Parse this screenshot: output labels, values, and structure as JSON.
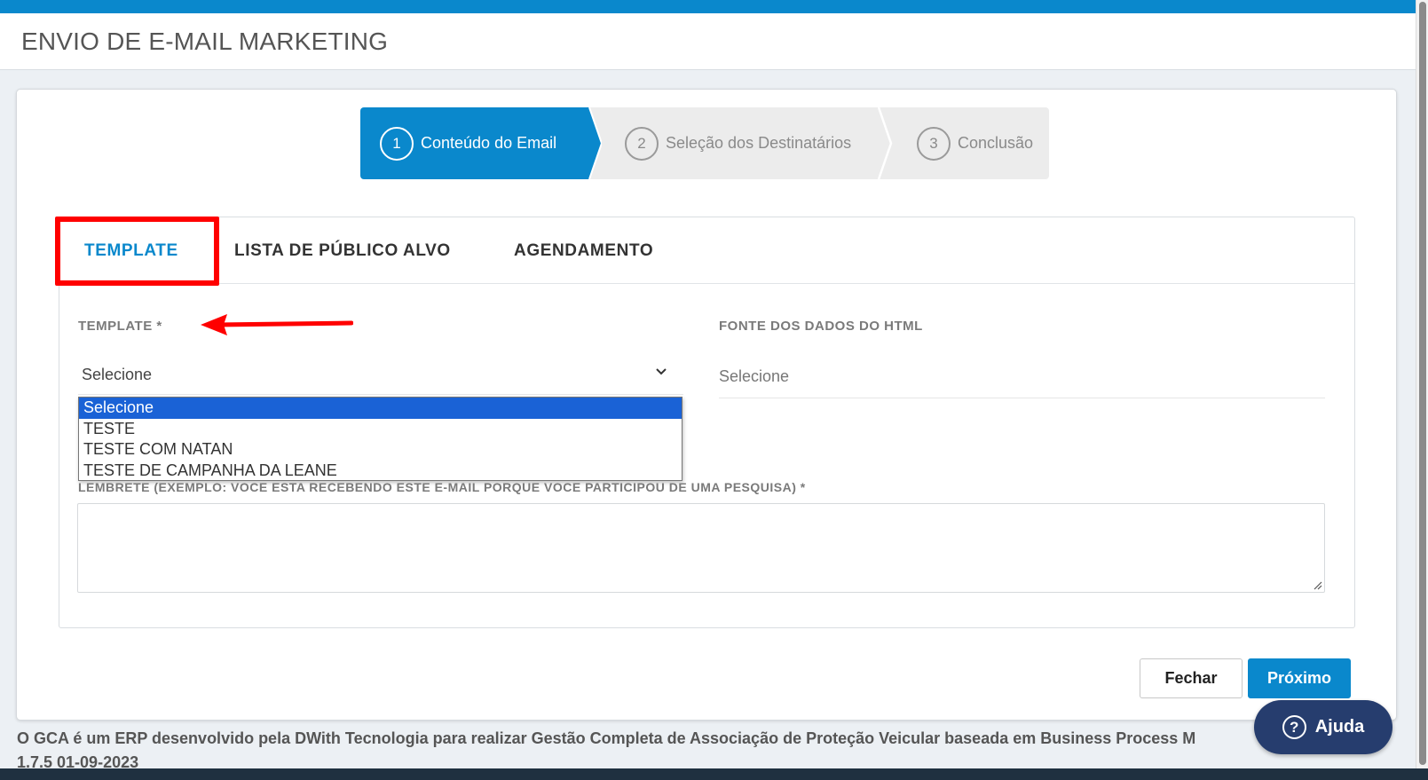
{
  "header": {
    "title": "ENVIO DE E-MAIL MARKETING"
  },
  "wizard": {
    "steps": [
      {
        "num": "1",
        "label": "Conteúdo do Email",
        "active": true
      },
      {
        "num": "2",
        "label": "Seleção dos Destinatários",
        "active": false
      },
      {
        "num": "3",
        "label": "Conclusão",
        "active": false
      }
    ]
  },
  "tabs": [
    {
      "label": "TEMPLATE",
      "active": true
    },
    {
      "label": "LISTA DE PÚBLICO ALVO",
      "active": false
    },
    {
      "label": "AGENDAMENTO",
      "active": false
    }
  ],
  "form": {
    "template_label": "TEMPLATE *",
    "template_value": "Selecione",
    "template_options": [
      "Selecione",
      "TESTE",
      "TESTE COM NATAN",
      "TESTE DE CAMPANHA DA LEANE"
    ],
    "fonte_label": "FONTE DOS DADOS DO HTML",
    "fonte_value": "Selecione",
    "lembrete_label": "LEMBRETE (EXEMPLO: VOCE ESTA RECEBENDO ESTE E-MAIL PORQUE VOCE PARTICIPOU DE UMA PESQUISA) *",
    "lembrete_value": ""
  },
  "buttons": {
    "fechar": "Fechar",
    "proximo": "Próximo"
  },
  "footer": {
    "line1": "O GCA é um ERP desenvolvido pela DWith Tecnologia para realizar Gestão Completa de Associação de Proteção Veicular baseada em Business Process M",
    "line2": "1.7.5 01-09-2023"
  },
  "help": {
    "label": "Ajuda",
    "icon": "question-circle-icon"
  },
  "colors": {
    "primary": "#0a88cc",
    "highlight": "#ff0000",
    "help_bg": "#263d6e"
  }
}
